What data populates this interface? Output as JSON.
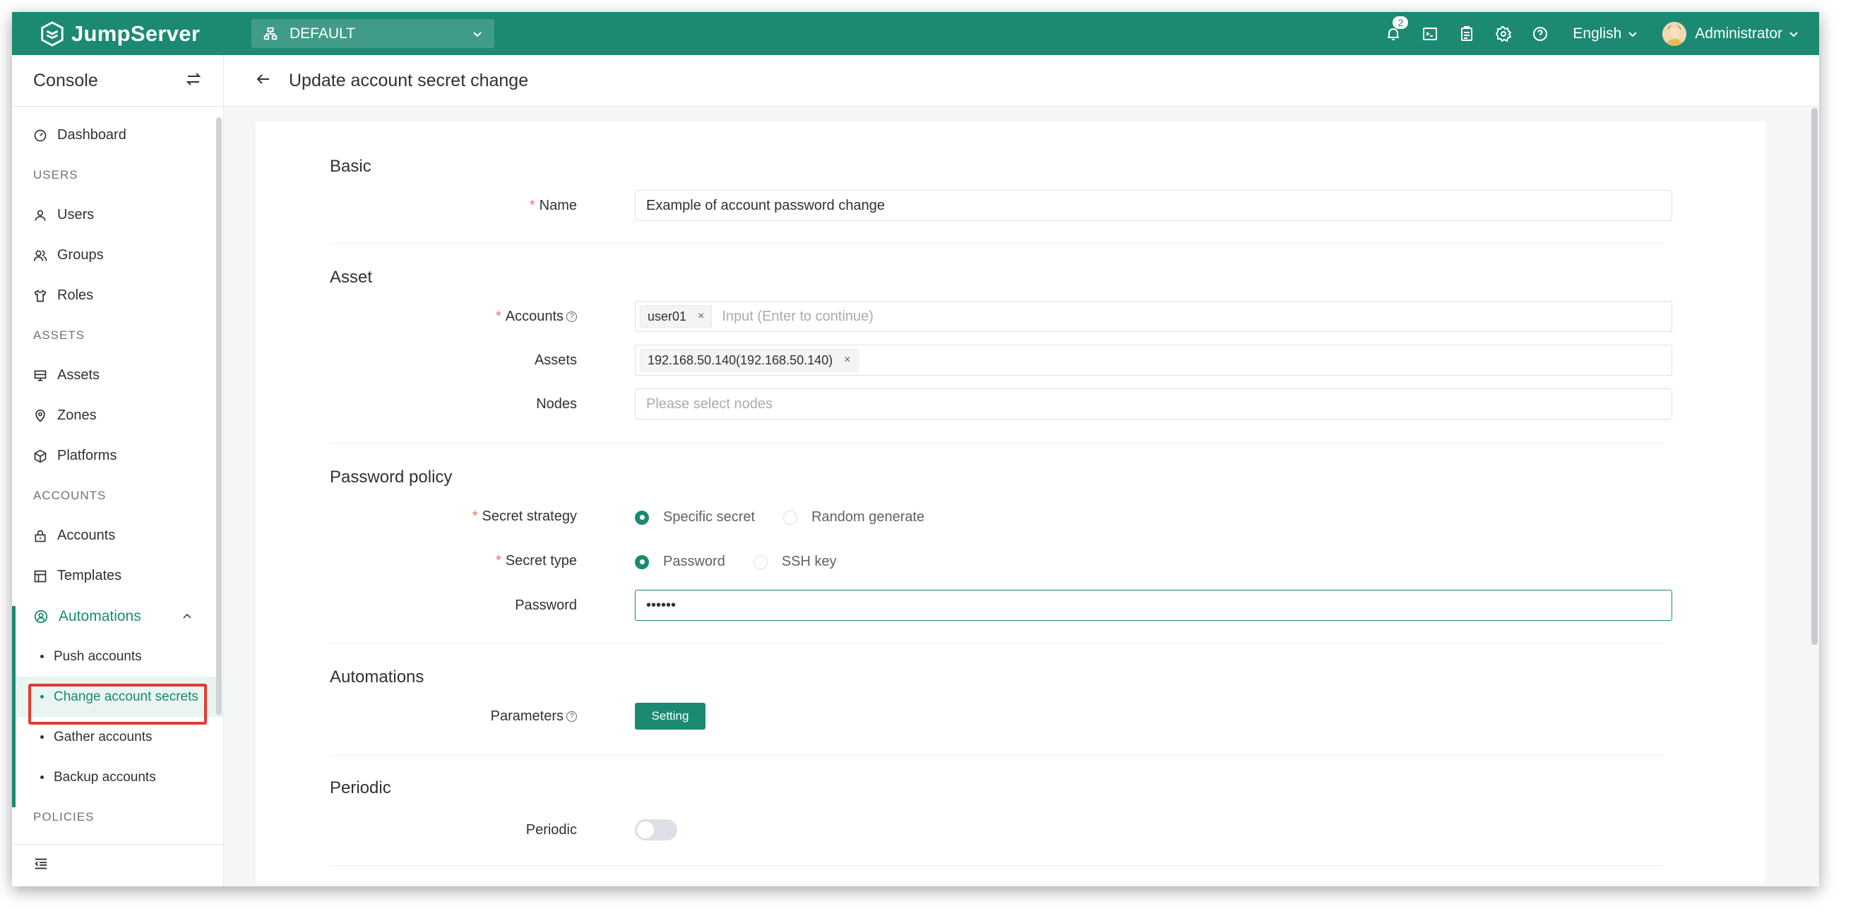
{
  "topbar": {
    "brand": "JumpServer",
    "org": "DEFAULT",
    "notification_count": "2",
    "language": "English",
    "user": "Administrator"
  },
  "sidebar": {
    "title": "Console",
    "dashboard": "Dashboard",
    "sections": {
      "users": "USERS",
      "assets": "ASSETS",
      "accounts": "ACCOUNTS",
      "policies": "POLICIES"
    },
    "users_items": [
      "Users",
      "Groups",
      "Roles"
    ],
    "assets_items": [
      "Assets",
      "Zones",
      "Platforms"
    ],
    "accounts_items": [
      "Accounts",
      "Templates"
    ],
    "automations": {
      "label": "Automations",
      "children": [
        "Push accounts",
        "Change account secrets",
        "Gather accounts",
        "Backup accounts"
      ],
      "active_index": 1
    }
  },
  "page": {
    "title": "Update account secret change"
  },
  "form": {
    "basic": {
      "title": "Basic",
      "name_label": "Name",
      "name_value": "Example of account password change"
    },
    "asset": {
      "title": "Asset",
      "accounts_label": "Accounts",
      "accounts_tag": "user01",
      "accounts_placeholder": "Input (Enter to continue)",
      "assets_label": "Assets",
      "assets_tag": "192.168.50.140(192.168.50.140)",
      "nodes_label": "Nodes",
      "nodes_placeholder": "Please select nodes"
    },
    "password_policy": {
      "title": "Password policy",
      "strategy_label": "Secret strategy",
      "strategy_options": [
        "Specific secret",
        "Random generate"
      ],
      "strategy_selected": "Specific secret",
      "type_label": "Secret type",
      "type_options": [
        "Password",
        "SSH key"
      ],
      "type_selected": "Password",
      "password_label": "Password",
      "password_value": "••••••"
    },
    "automations": {
      "title": "Automations",
      "parameters_label": "Parameters",
      "setting_button": "Setting"
    },
    "periodic": {
      "title": "Periodic",
      "periodic_label": "Periodic",
      "periodic_enabled": false
    }
  },
  "colors": {
    "brand": "#1c8a72",
    "required": "#f56c6c",
    "highlight": "#e53935"
  }
}
